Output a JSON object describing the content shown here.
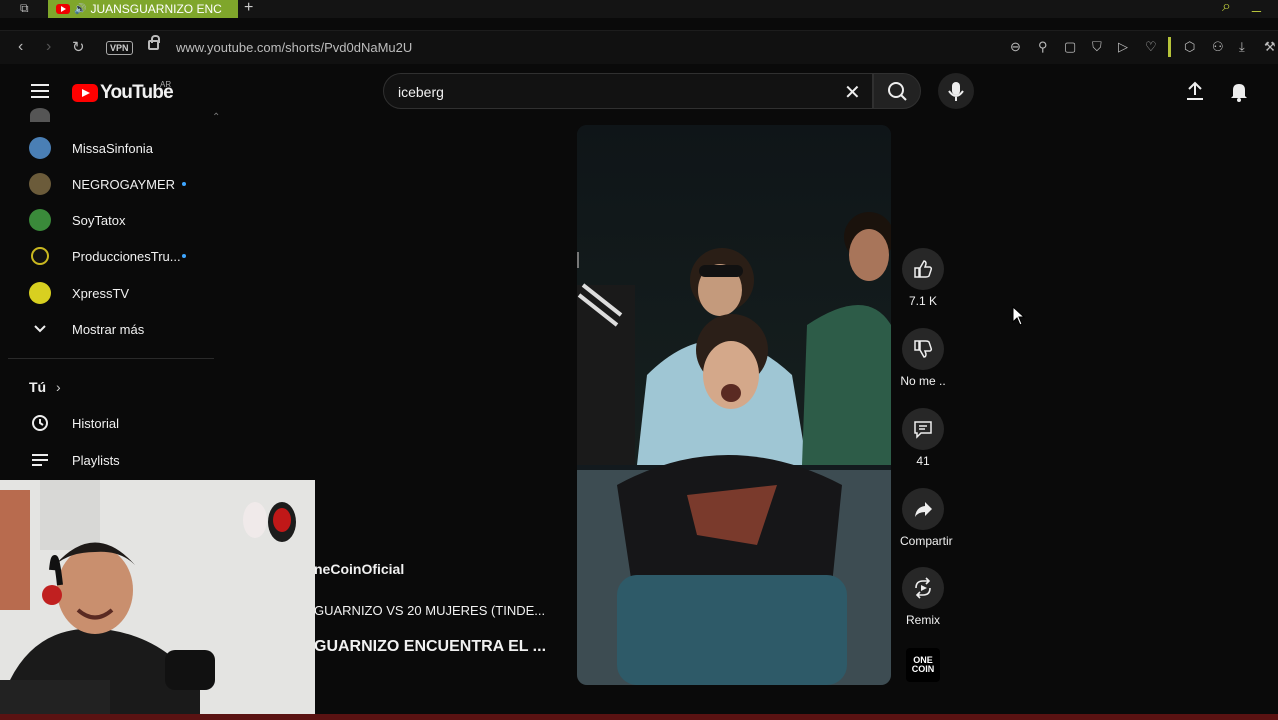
{
  "browser": {
    "tab_title": "JUANSGUARNIZO ENC",
    "url": "www.youtube.com/shorts/Pvd0dNaMu2U",
    "vpn_label": "VPN"
  },
  "header": {
    "logo_text": "YouTube",
    "country_code": "AR",
    "search_value": "iceberg"
  },
  "sidebar": {
    "subscriptions": [
      {
        "label": "MissaSinfonia",
        "avatar_color": "#4a7fb5",
        "new": false
      },
      {
        "label": "NEGROGAYMER",
        "avatar_color": "#6b5b3a",
        "new": true
      },
      {
        "label": "SoyTatox",
        "avatar_color": "#3a8a3a",
        "new": false
      },
      {
        "label": "ProduccionesTru...",
        "avatar_color": "#c9b820",
        "new": true
      },
      {
        "label": "XpressTV",
        "avatar_color": "#d8d020",
        "new": false
      }
    ],
    "show_more": "Mostrar más",
    "you_section": "Tú",
    "history": "Historial",
    "playlists": "Playlists"
  },
  "short": {
    "like_count": "7.1 K",
    "dislike_label": "No me ..",
    "comment_count": "41",
    "share_label": "Compartir",
    "remix_label": "Remix",
    "channel_badge": "ONE COIN"
  },
  "overlay": {
    "channel_name": "neCoinOficial",
    "video_title_1": "GUARNIZO VS 20 MUJERES (TINDE...",
    "video_title_2": "GUARNIZO ENCUENTRA EL ..."
  }
}
